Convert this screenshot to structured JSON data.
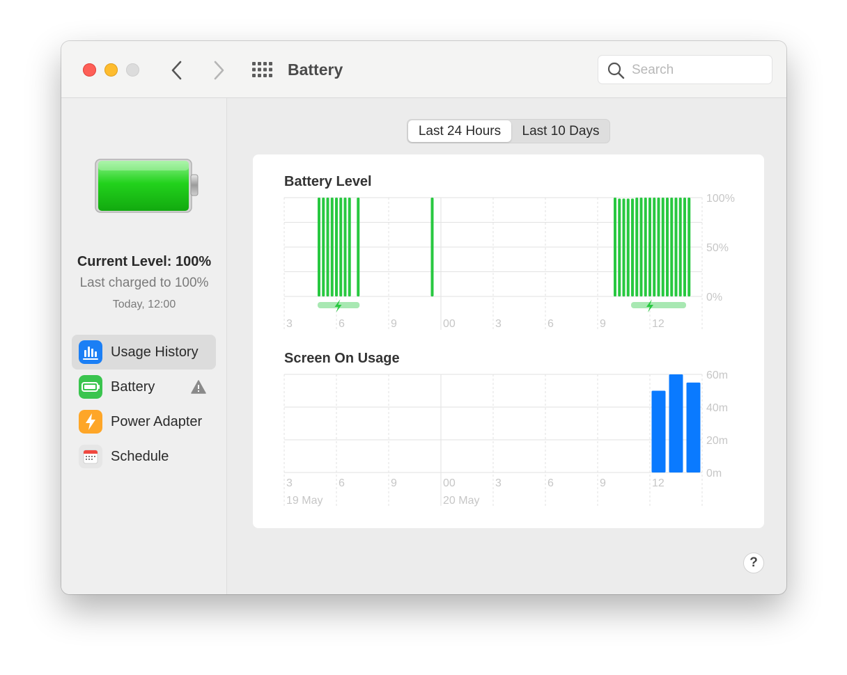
{
  "window": {
    "title": "Battery",
    "search_placeholder": "Search"
  },
  "sidebar": {
    "current_level": "Current Level: 100%",
    "last_charged": "Last charged to 100%",
    "charge_time": "Today, 12:00",
    "items": [
      {
        "label": "Usage History",
        "icon": "usage-history-icon",
        "selected": true
      },
      {
        "label": "Battery",
        "icon": "battery-icon",
        "warning": true
      },
      {
        "label": "Power Adapter",
        "icon": "power-adapter-icon"
      },
      {
        "label": "Schedule",
        "icon": "schedule-icon"
      }
    ]
  },
  "segmented": {
    "options": [
      "Last 24 Hours",
      "Last 10 Days"
    ],
    "selected": "Last 24 Hours"
  },
  "help_label": "?",
  "colors": {
    "battery_bar": "#28c840",
    "screen_bar": "#0a7aff",
    "charging_band": "#a8e8b2",
    "charging_bolt": "#28c840",
    "grid": "#e2e2e2",
    "tick_text": "#c6c6c6"
  },
  "chart_data": [
    {
      "type": "bar",
      "title": "Battery Level",
      "x_tick_labels": [
        "3",
        "6",
        "9",
        "00",
        "3",
        "6",
        "9",
        "12"
      ],
      "y_tick_labels": [
        "100%",
        "50%",
        "0%"
      ],
      "ylim": [
        0,
        100
      ],
      "bars": [
        {
          "hour": 2.0,
          "value": 100
        },
        {
          "hour": 2.25,
          "value": 100
        },
        {
          "hour": 2.5,
          "value": 100
        },
        {
          "hour": 2.75,
          "value": 100
        },
        {
          "hour": 3.0,
          "value": 100
        },
        {
          "hour": 3.25,
          "value": 100
        },
        {
          "hour": 3.5,
          "value": 100
        },
        {
          "hour": 3.75,
          "value": 100
        },
        {
          "hour": 4.25,
          "value": 100
        },
        {
          "hour": 8.5,
          "value": 100
        },
        {
          "hour": 19.0,
          "value": 100
        },
        {
          "hour": 19.25,
          "value": 99
        },
        {
          "hour": 19.5,
          "value": 99
        },
        {
          "hour": 19.75,
          "value": 99
        },
        {
          "hour": 20.0,
          "value": 99
        },
        {
          "hour": 20.25,
          "value": 100
        },
        {
          "hour": 20.5,
          "value": 100
        },
        {
          "hour": 20.75,
          "value": 100
        },
        {
          "hour": 21.0,
          "value": 100
        },
        {
          "hour": 21.25,
          "value": 100
        },
        {
          "hour": 21.5,
          "value": 100
        },
        {
          "hour": 21.75,
          "value": 100
        },
        {
          "hour": 22.0,
          "value": 100
        },
        {
          "hour": 22.25,
          "value": 100
        },
        {
          "hour": 22.5,
          "value": 100
        },
        {
          "hour": 22.75,
          "value": 100
        },
        {
          "hour": 23.0,
          "value": 100
        },
        {
          "hour": 23.25,
          "value": 100
        }
      ],
      "charging": [
        {
          "start": 2.0,
          "end": 4.25,
          "bolt": 3.1
        },
        {
          "start": 20.0,
          "end": 23.0,
          "bolt": 21.0
        }
      ]
    },
    {
      "type": "bar",
      "title": "Screen On Usage",
      "x_tick_labels": [
        "3",
        "6",
        "9",
        "00",
        "3",
        "6",
        "9",
        "12"
      ],
      "date_labels": [
        "19 May",
        "20 May"
      ],
      "y_tick_labels": [
        "60m",
        "40m",
        "20m",
        "0m"
      ],
      "ylim": [
        0,
        60
      ],
      "unit": "minutes",
      "bars": [
        {
          "hour": 21,
          "value": 50
        },
        {
          "hour": 22,
          "value": 60
        },
        {
          "hour": 23,
          "value": 55
        }
      ]
    }
  ]
}
